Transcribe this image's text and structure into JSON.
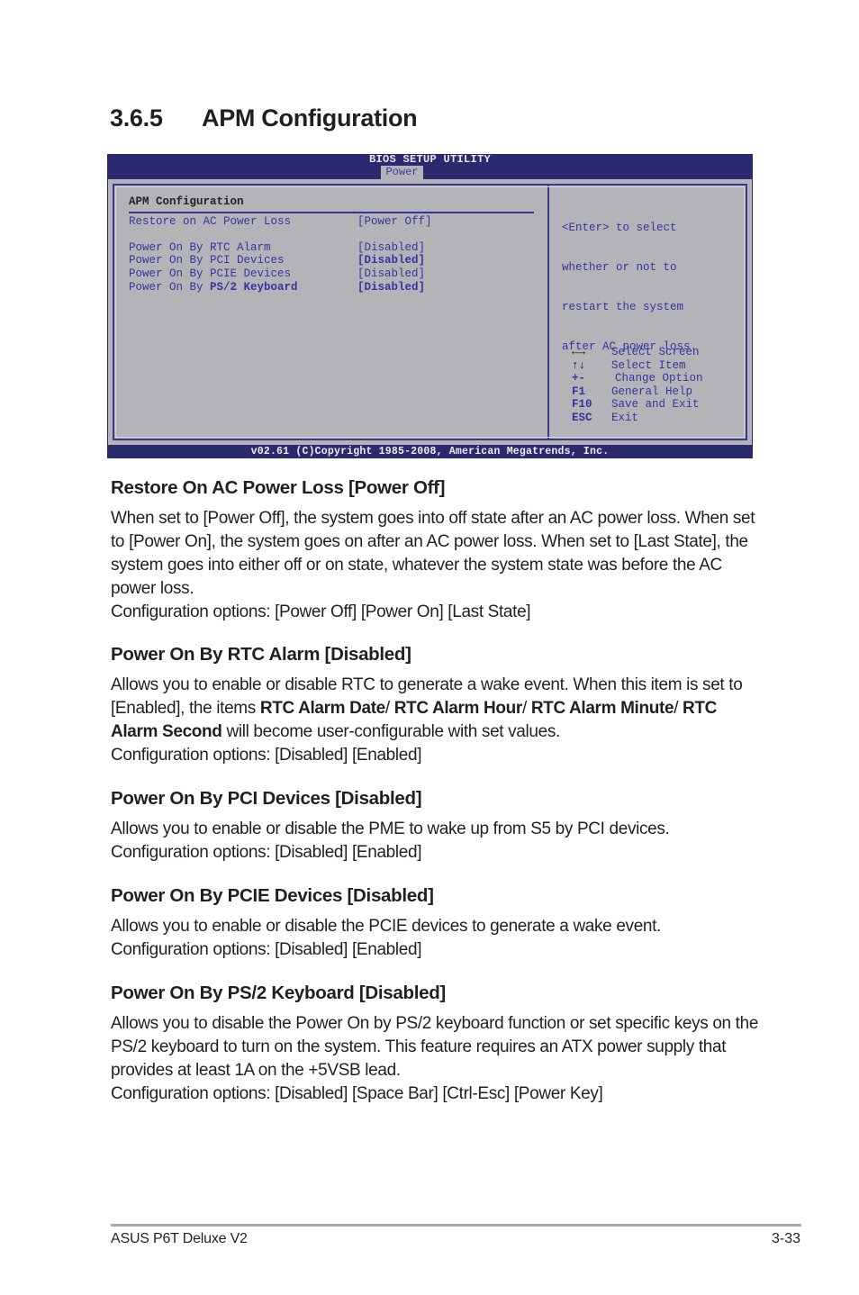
{
  "section": {
    "number": "3.6.5",
    "title": "APM Configuration"
  },
  "bios": {
    "title": "BIOS SETUP UTILITY",
    "active_tab": "Power",
    "panel_heading": "APM Configuration",
    "items": [
      {
        "label": "Restore on AC Power Loss",
        "value": "[Power Off]"
      },
      {
        "label": "Power On By RTC Alarm",
        "value": "[Disabled]"
      },
      {
        "label": "Power On By PCI Devices",
        "value": "[Disabled]"
      },
      {
        "label": "Power On By PCIE Devices",
        "value": "[Disabled]"
      },
      {
        "label": "Power On By PS/2 Keyboard",
        "value": "[Disabled]"
      }
    ],
    "help_lines": [
      "<Enter> to select",
      "whether or not to",
      "restart the system",
      "after AC power loss."
    ],
    "keys": [
      {
        "key": "←→",
        "icon": "left-right-arrows-icon",
        "desc": "Select Screen"
      },
      {
        "key": "↑↓",
        "icon": "up-down-arrows-icon",
        "desc": "Select Item"
      },
      {
        "key": "+-",
        "icon": "plus-minus-icon",
        "desc": "Change Option"
      },
      {
        "key": "F1",
        "desc": "General Help"
      },
      {
        "key": "F10",
        "desc": "Save and Exit"
      },
      {
        "key": "ESC",
        "desc": "Exit"
      }
    ],
    "copyright": "v02.61 (C)Copyright 1985-2008, American Megatrends, Inc."
  },
  "descriptions": [
    {
      "heading": "Restore On AC Power Loss [Power Off]",
      "text": "When set to [Power Off], the system goes into off state after an AC power loss. When set to [Power On], the system goes on after an AC power loss. When set to [Last State], the system goes into either off or on state, whatever the system state was before the AC power loss.",
      "options": "Configuration options: [Power Off] [Power On] [Last State]"
    },
    {
      "heading": "Power On By RTC Alarm [Disabled]",
      "text_before": "Allows you to enable or disable RTC to generate a wake event. When this item is set to [Enabled], the items ",
      "bold_1": "RTC Alarm Date",
      "sep_1": "/ ",
      "bold_2": "RTC Alarm Hour",
      "sep_2": "/ ",
      "bold_3": "RTC Alarm Minute",
      "sep_3": "/ ",
      "bold_4": "RTC Alarm Second",
      "text_after": " will become user-configurable with set values.",
      "options": "Configuration options: [Disabled] [Enabled]"
    },
    {
      "heading": "Power On By PCI Devices [Disabled]",
      "text": "Allows you to enable or disable the PME to wake up from S5 by PCI devices.",
      "options": "Configuration options: [Disabled] [Enabled]"
    },
    {
      "heading": "Power On By PCIE Devices [Disabled]",
      "text": "Allows you to enable or disable the PCIE devices to generate a wake event.",
      "options": "Configuration options: [Disabled] [Enabled]"
    },
    {
      "heading": "Power On By PS/2 Keyboard [Disabled]",
      "text": "Allows you to disable the Power On by PS/2 keyboard function or set specific keys on the PS/2 keyboard to turn on the system. This feature requires an ATX power supply that provides at least 1A on the +5VSB lead.",
      "options": "Configuration options: [Disabled] [Space Bar] [Ctrl-Esc] [Power Key]"
    }
  ],
  "footer": {
    "product": "ASUS P6T Deluxe V2",
    "page": "3-33"
  }
}
